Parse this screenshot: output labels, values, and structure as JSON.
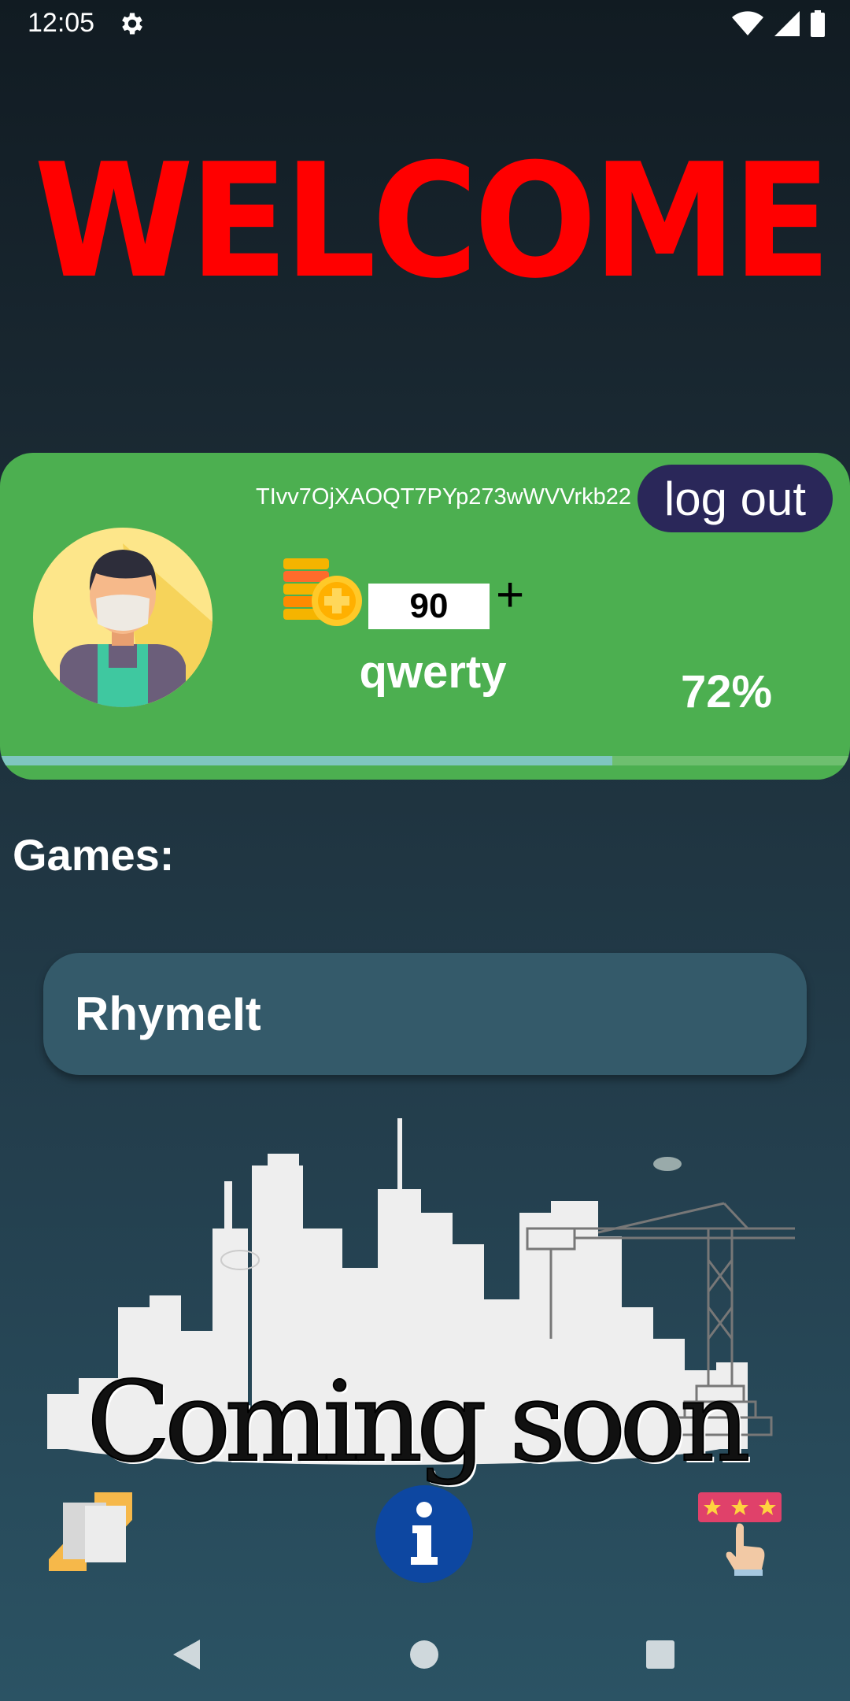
{
  "status_bar": {
    "time": "12:05"
  },
  "header": {
    "welcome_text": "WELCOME"
  },
  "profile": {
    "user_id": "TIvv7OjXAOQT7PYp273wWVVrkb22",
    "logout_label": "log out",
    "coins": "90",
    "add_coins_label": "+",
    "username": "qwerty",
    "progress_text": "72%",
    "progress_fraction": 0.72
  },
  "games": {
    "heading": "Games:",
    "items": [
      {
        "title": "RhymeIt"
      }
    ],
    "coming_soon_text": "Coming soon"
  },
  "bottom_actions": {
    "share_icon": "share-hands-icon",
    "info_icon": "info-icon",
    "rate_icon": "rate-stars-icon"
  },
  "colors": {
    "welcome": "#ff0000",
    "card": "#4caf50",
    "logout_bg": "#2a2759",
    "game_card": "#345a6a",
    "info_blue": "#0d47a1"
  }
}
